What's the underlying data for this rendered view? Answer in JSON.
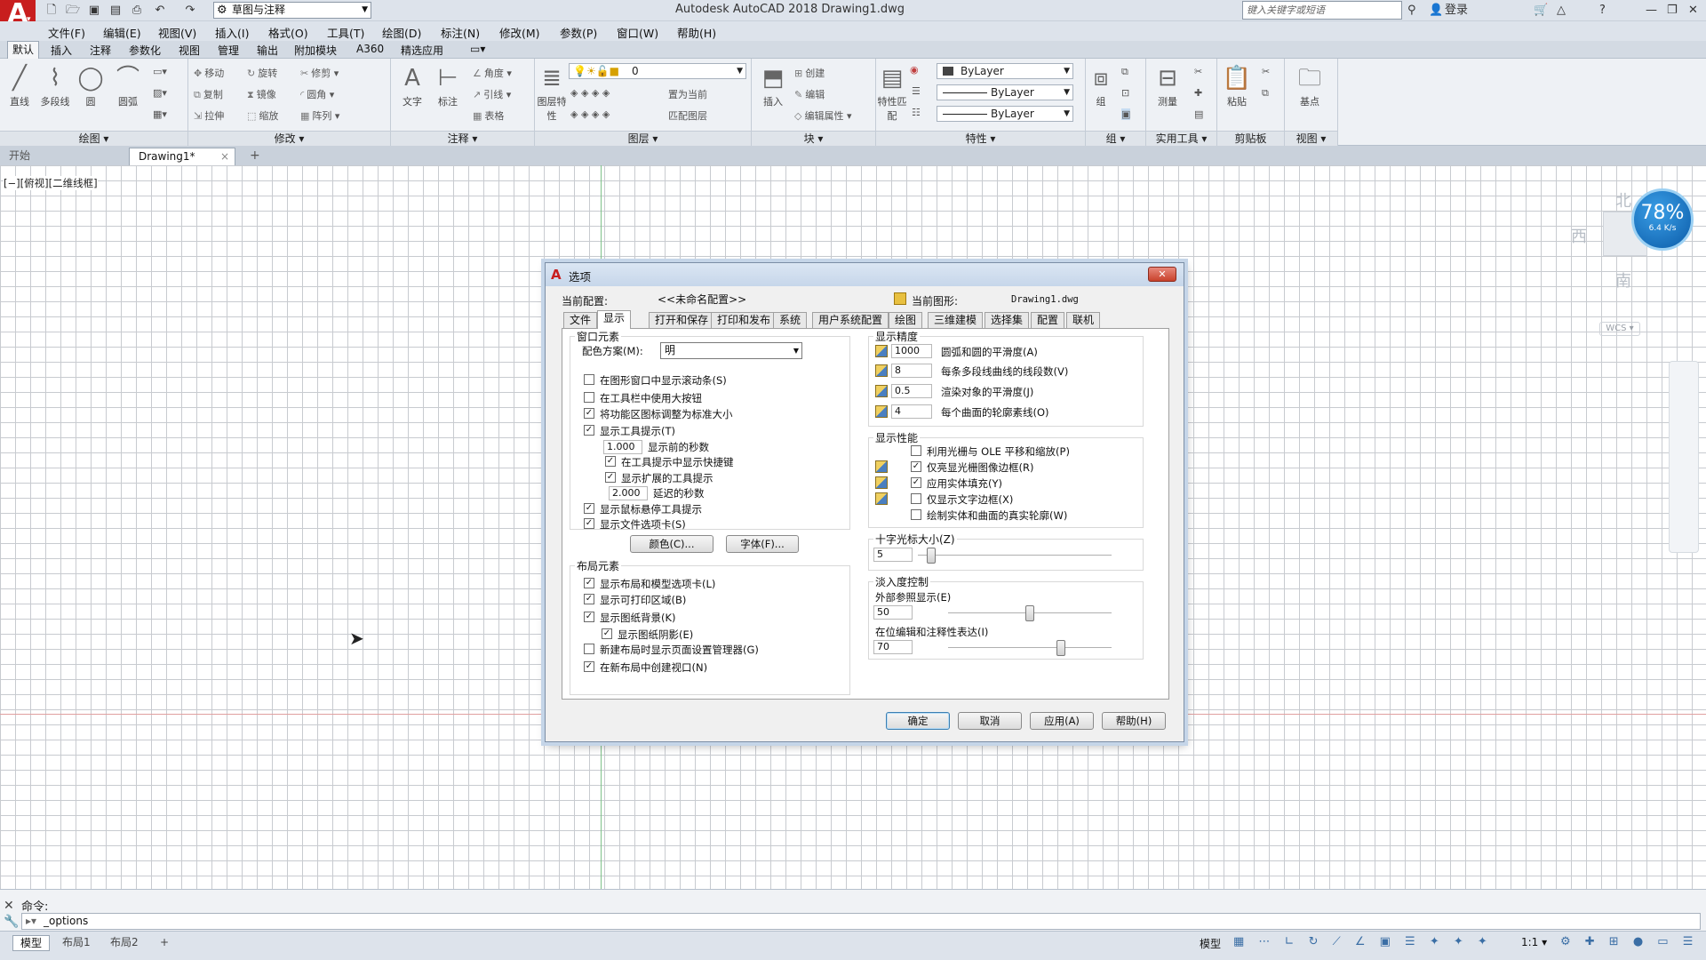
{
  "app": {
    "title": "Autodesk AutoCAD 2018    Drawing1.dwg",
    "logo": "A",
    "workspace": "草图与注释",
    "search_placeholder": "键入关键字或短语",
    "login": "登录"
  },
  "menu": [
    "文件(F)",
    "编辑(E)",
    "视图(V)",
    "插入(I)",
    "格式(O)",
    "工具(T)",
    "绘图(D)",
    "标注(N)",
    "修改(M)",
    "参数(P)",
    "窗口(W)",
    "帮助(H)"
  ],
  "ribbon_tabs": [
    "默认",
    "插入",
    "注释",
    "参数化",
    "视图",
    "管理",
    "输出",
    "附加模块",
    "A360",
    "精选应用"
  ],
  "ribbon_panels": {
    "draw": {
      "title": "绘图 ▾",
      "tools": [
        "直线",
        "多段线",
        "圆",
        "圆弧"
      ]
    },
    "modify": {
      "title": "修改 ▾",
      "tools": [
        "移动",
        "旋转",
        "修剪",
        "复制",
        "镜像",
        "圆角",
        "拉伸",
        "缩放",
        "阵列"
      ]
    },
    "annotation": {
      "title": "注释 ▾",
      "tools": [
        "文字",
        "标注",
        "角度",
        "引线",
        "表格"
      ]
    },
    "layer": {
      "title": "图层 ▾",
      "tools": [
        "图层特性",
        "置为当前",
        "匹配图层"
      ],
      "current": "0"
    },
    "block": {
      "title": "块 ▾",
      "tools": [
        "插入",
        "创建",
        "编辑",
        "编辑属性"
      ]
    },
    "properties": {
      "title": "特性 ▾",
      "tools": [
        "特性匹配"
      ],
      "color": "ByLayer",
      "linetype": "ByLayer",
      "lineweight": "ByLayer"
    },
    "group": {
      "title": "组 ▾",
      "tools": [
        "组"
      ]
    },
    "utilities": {
      "title": "实用工具 ▾",
      "tools": [
        "测量"
      ]
    },
    "clipboard": {
      "title": "剪贴板",
      "tools": [
        "粘贴"
      ]
    },
    "view": {
      "title": "视图 ▾",
      "tools": [
        "基点"
      ]
    }
  },
  "file_tabs": {
    "start": "开始",
    "doc": "Drawing1*",
    "close": "×",
    "add": "+"
  },
  "viewport_label": "[−][俯视][二维线框]",
  "viewcube": {
    "north": "北",
    "west": "西",
    "south": "南",
    "wcs": "WCS ▾"
  },
  "speed_badge": {
    "percent": "78%",
    "rate": "6.4 K/s"
  },
  "command": {
    "history": "命令:",
    "input": "_options",
    "prompt": "▸▾"
  },
  "layout_tabs": [
    "模型",
    "布局1",
    "布局2",
    "+"
  ],
  "status": {
    "model": "模型",
    "scale": "1:1 ▾"
  },
  "dialog": {
    "title": "选项",
    "close": "✕",
    "profile_label": "当前配置:",
    "profile_value": "<<未命名配置>>",
    "drawing_label": "当前图形:",
    "drawing_value": "Drawing1.dwg",
    "tabs": [
      "文件",
      "显示",
      "打开和保存",
      "打印和发布",
      "系统",
      "用户系统配置",
      "绘图",
      "三维建模",
      "选择集",
      "配置",
      "联机"
    ],
    "window_elements": {
      "title": "窗口元素",
      "scheme_label": "配色方案(M):",
      "scheme_value": "明",
      "items": [
        {
          "label": "在图形窗口中显示滚动条(S)",
          "checked": false
        },
        {
          "label": "在工具栏中使用大按钮",
          "checked": false
        },
        {
          "label": "将功能区图标调整为标准大小",
          "checked": true
        },
        {
          "label": "显示工具提示(T)",
          "checked": true
        }
      ],
      "tooltip_delay_value": "1.000",
      "tooltip_delay_label": "显示前的秒数",
      "sub_items": [
        {
          "label": "在工具提示中显示快捷键",
          "checked": true
        },
        {
          "label": "显示扩展的工具提示",
          "checked": true
        }
      ],
      "ext_delay_value": "2.000",
      "ext_delay_label": "延迟的秒数",
      "items2": [
        {
          "label": "显示鼠标悬停工具提示",
          "checked": true
        },
        {
          "label": "显示文件选项卡(S)",
          "checked": true
        }
      ],
      "color_button": "颜色(C)...",
      "font_button": "字体(F)..."
    },
    "layout_elements": {
      "title": "布局元素",
      "items": [
        {
          "label": "显示布局和模型选项卡(L)",
          "checked": true
        },
        {
          "label": "显示可打印区域(B)",
          "checked": true
        },
        {
          "label": "显示图纸背景(K)",
          "checked": true
        },
        {
          "label": "显示图纸阴影(E)",
          "checked": true
        },
        {
          "label": "新建布局时显示页面设置管理器(G)",
          "checked": false
        },
        {
          "label": "在新布局中创建视口(N)",
          "checked": true
        }
      ]
    },
    "display_resolution": {
      "title": "显示精度",
      "items": [
        {
          "value": "1000",
          "label": "圆弧和圆的平滑度(A)"
        },
        {
          "value": "8",
          "label": "每条多段线曲线的线段数(V)"
        },
        {
          "value": "0.5",
          "label": "渲染对象的平滑度(J)"
        },
        {
          "value": "4",
          "label": "每个曲面的轮廓素线(O)"
        }
      ]
    },
    "display_performance": {
      "title": "显示性能",
      "items": [
        {
          "label": "利用光栅与 OLE 平移和缩放(P)",
          "checked": false
        },
        {
          "label": "仅亮显光栅图像边框(R)",
          "checked": true
        },
        {
          "label": "应用实体填充(Y)",
          "checked": true
        },
        {
          "label": "仅显示文字边框(X)",
          "checked": false
        },
        {
          "label": "绘制实体和曲面的真实轮廓(W)",
          "checked": false
        }
      ]
    },
    "crosshair": {
      "title": "十字光标大小(Z)",
      "value": "5",
      "fraction": 0.05
    },
    "fade": {
      "title": "淡入度控制",
      "xref_label": "外部参照显示(E)",
      "xref_value": "50",
      "xref_fraction": 0.5,
      "inplace_label": "在位编辑和注释性表达(I)",
      "inplace_value": "70",
      "inplace_fraction": 0.7
    },
    "buttons": {
      "ok": "确定",
      "cancel": "取消",
      "apply": "应用(A)",
      "help": "帮助(H)"
    }
  }
}
